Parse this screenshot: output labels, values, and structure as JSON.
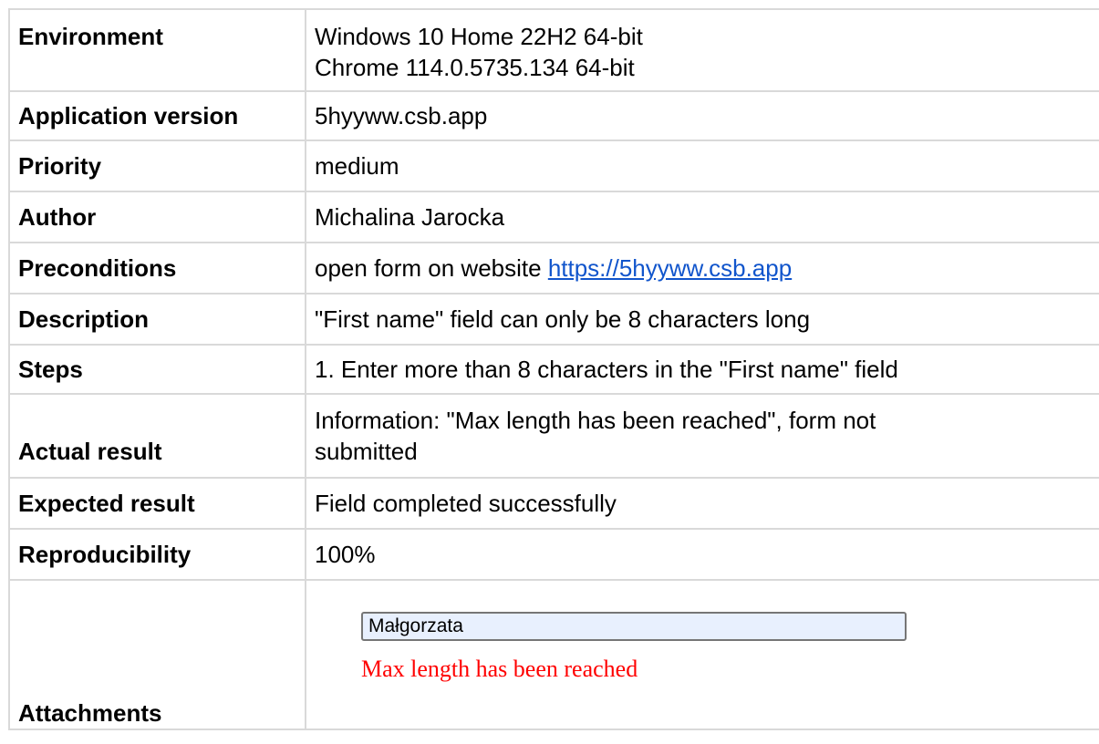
{
  "rows": {
    "environment": {
      "label": "Environment",
      "value_line1": "Windows 10 Home 22H2 64-bit",
      "value_line2": "Chrome 114.0.5735.134 64-bit"
    },
    "application_version": {
      "label": "Application version",
      "value": "5hyyww.csb.app"
    },
    "priority": {
      "label": "Priority",
      "value": "medium"
    },
    "author": {
      "label": "Author",
      "value": "Michalina Jarocka"
    },
    "preconditions": {
      "label": "Preconditions",
      "value_text": "open form on website ",
      "link_text": "https://5hyyww.csb.app"
    },
    "description": {
      "label": "Description",
      "value": "\"First name\" field can only be 8 characters long"
    },
    "steps": {
      "label": "Steps",
      "value": "1. Enter more than 8 characters in the \"First name\" field"
    },
    "actual_result": {
      "label": "Actual result",
      "value_line1": "Information: \"Max length has been reached\", form not",
      "value_line2": "submitted"
    },
    "expected_result": {
      "label": "Expected result",
      "value": "Field completed successfully"
    },
    "reproducibility": {
      "label": "Reproducibility",
      "value": "100%"
    },
    "attachments": {
      "label": "Attachments",
      "input_value": "Małgorzata",
      "error_message": "Max length has been reached"
    }
  },
  "colors": {
    "link": "#1155cc",
    "error": "#ff0000",
    "border": "#d9d9d9",
    "input_background": "#e8f0fe"
  }
}
